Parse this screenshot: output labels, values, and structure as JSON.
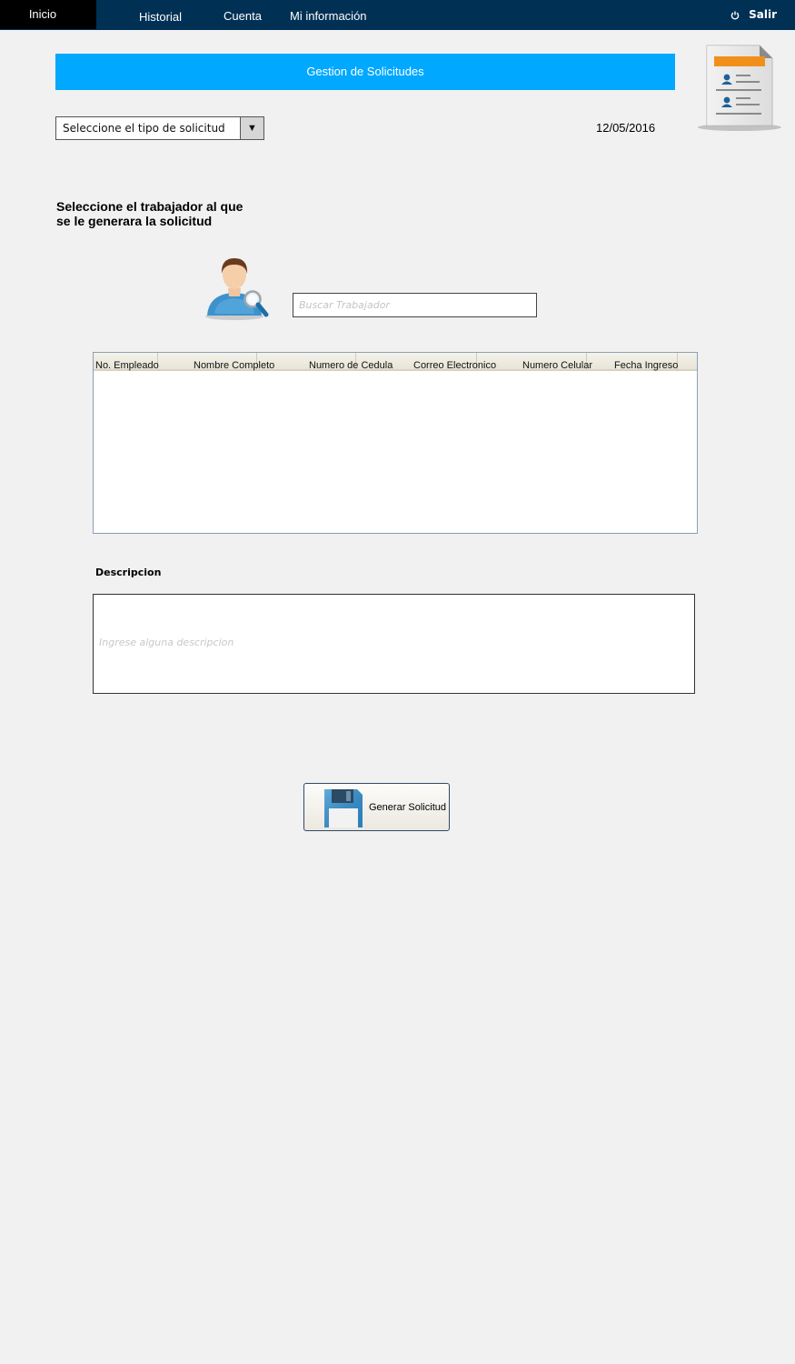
{
  "nav": {
    "items": [
      {
        "label": "Inicio",
        "active": true
      },
      {
        "label": "Historial"
      },
      {
        "label": "Cuenta"
      },
      {
        "label": "Mi información"
      }
    ],
    "logout_label": "Salir"
  },
  "page": {
    "title": "Gestion de Solicitudes",
    "date": "12/05/2016"
  },
  "request_type": {
    "selected": "Seleccione el tipo de solicitud"
  },
  "worker": {
    "heading_line1": "Seleccione el trabajador al que",
    "heading_line2": "se le generara la solicitud",
    "search_placeholder": "Buscar Trabajador"
  },
  "table": {
    "columns": [
      "No. Empleado",
      "Nombre Completo",
      "Numero de Cedula",
      "Correo Electronico",
      "Numero Celular",
      "Fecha Ingreso"
    ],
    "rows": []
  },
  "description": {
    "label": "Descripcion",
    "placeholder": "Ingrese alguna descripcion"
  },
  "actions": {
    "generate_label": "Generar Solicitud"
  },
  "colors": {
    "nav_bg": "#003155",
    "nav_active_bg": "#000000",
    "title_bar": "#00a8ff",
    "page_bg": "#f1f1f1"
  },
  "icons": {
    "logout": "power-icon",
    "document": "document-contacts-icon",
    "worker_search": "user-search-icon",
    "save": "floppy-disk-icon",
    "dropdown": "triangle-down-icon"
  }
}
